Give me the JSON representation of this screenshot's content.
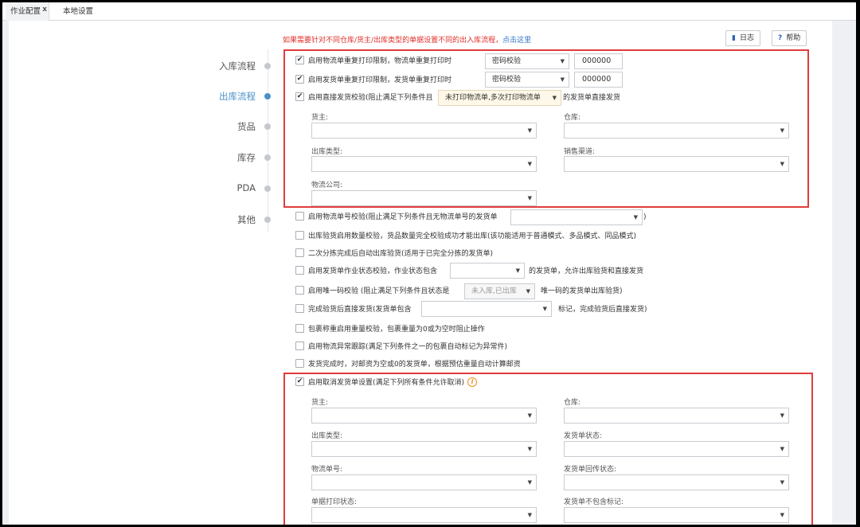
{
  "tabs": {
    "active": "作业配置",
    "close_mark": "x",
    "other": "本地设置"
  },
  "notice": {
    "text": "如果需要针对不同仓库/货主/出库类型的单据设置不同的出入库流程，",
    "link": "点击这里"
  },
  "toolbar": {
    "log_icon": "log-book-icon",
    "log": "日志",
    "help_icon": "?",
    "help": "帮助"
  },
  "nav": {
    "inbound": "入库流程",
    "outbound": "出库流程",
    "goods": "货品",
    "stock": "库存",
    "pda": "PDA",
    "other": "其他"
  },
  "print_limits": {
    "row1": {
      "label": "启用物流单重复打印限制，物流单重复打印时",
      "select": "密码校验",
      "password": "000000",
      "checked": true
    },
    "row2": {
      "label": "启用发货单重复打印限制，发货单重复打印时",
      "select": "密码校验",
      "password": "000000",
      "checked": true
    },
    "row3": {
      "label_pre": "启用直接发货校验(阻止满足下列条件且",
      "tooltip": "未打印物流单,多次打印物流单",
      "label_post": "的发货单直接发货",
      "checked": true
    }
  },
  "direct_ship_fields": {
    "owner": "货主:",
    "warehouse": "仓库:",
    "out_type": "出库类型:",
    "channel": "销售渠道:",
    "logistics": "物流公司:"
  },
  "options": {
    "opt1_pre": "启用物流单号校验(阻止满足下列条件且无物流单号的发货单",
    "opt1_post": ")",
    "opt2": "出库验货启用数量校验，货品数量完全校验成功才能出库(该功能适用于普通模式、多品模式、同品模式)",
    "opt3": "二次分拣完成后自动出库验货(适用于已完全分拣的发货单)",
    "opt4_pre": "启用发货单作业状态校验，作业状态包含",
    "opt4_post": "的发货单，允许出库验货和直接发货",
    "opt5_pre": "启用唯一码校验  (阻止满足下列条件且状态是",
    "opt5_select": "未入库,已出库",
    "opt5_post": "唯一码的发货单出库验货)",
    "opt6_pre": "完成验货后直接发货(发货单包含",
    "opt6_post": "标记，完成验货后直接发货)",
    "opt7": "包裹称重启用重量校验，包裹重量为0或为空时阻止操作",
    "opt8": "启用物流异常跟踪(满足下列条件之一的包裹自动标记为异常件)",
    "opt9": "发货完成时，对邮资为空或0的发货单，根据预估重量自动计算邮资"
  },
  "cancel": {
    "label": "启用取消发货单设置(满足下列所有条件允许取消)",
    "info_icon": "i",
    "checked": true,
    "owner": "货主:",
    "warehouse": "仓库:",
    "out_type": "出库类型:",
    "ship_status": "发货单状态:",
    "tracking_no": "物流单号:",
    "return_status": "发货单回传状态:",
    "print_status": "单据打印状态:",
    "exclude_tags": "发货单不包含标记:"
  },
  "colors": {
    "accent": "#4a90c8",
    "highlight_box": "#e03c3c",
    "notice": "#e0302b"
  }
}
